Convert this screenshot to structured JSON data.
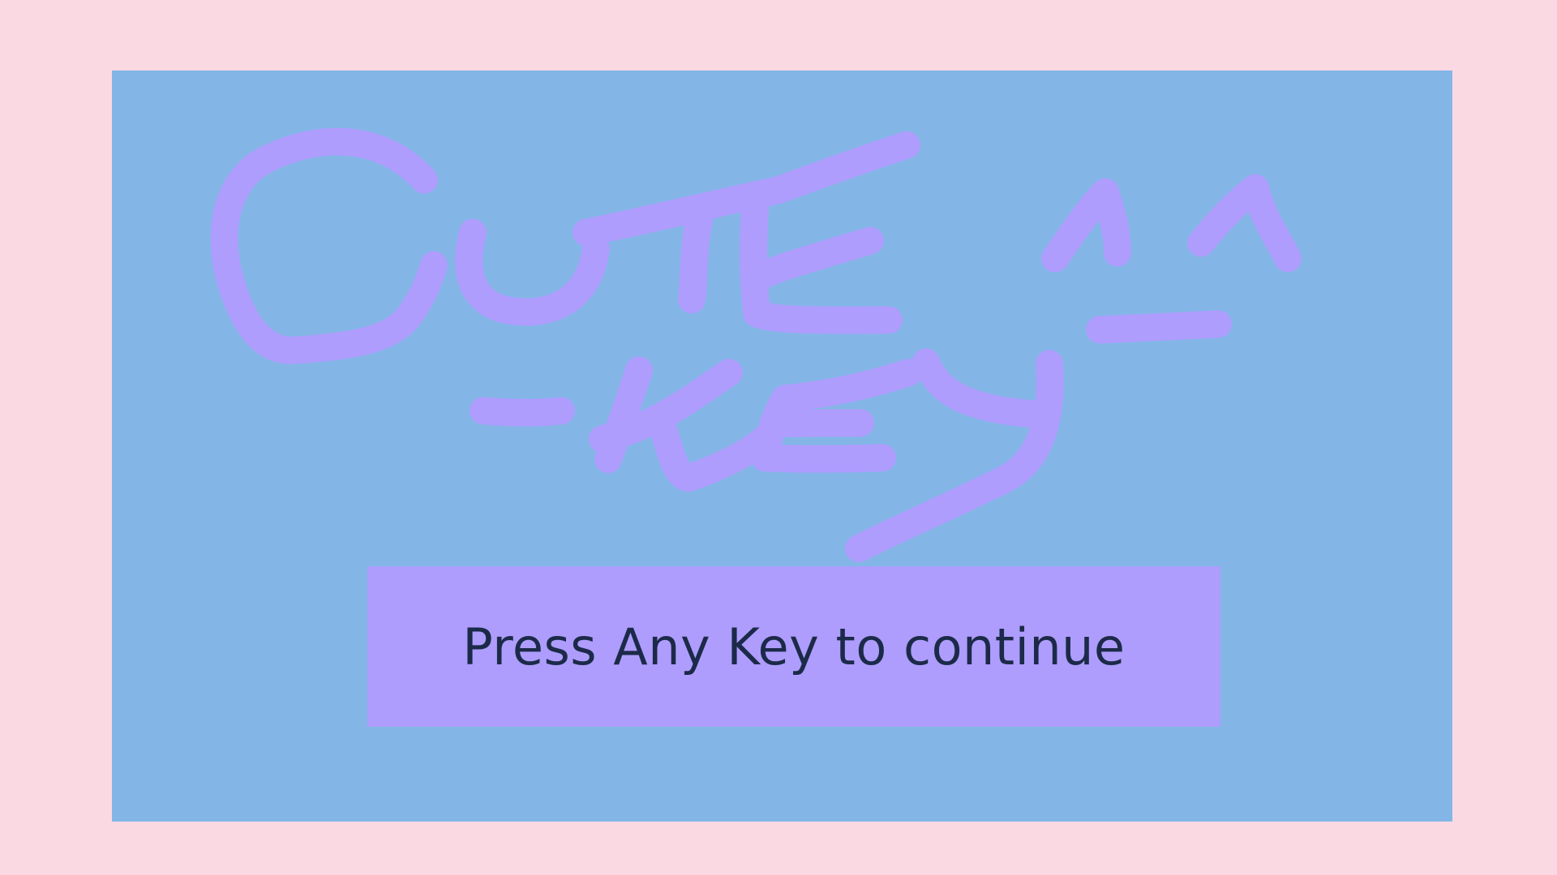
{
  "colors": {
    "outer_background": "#fad9e3",
    "screen_background": "#83b6e7",
    "logo_stroke": "#ae9dfd",
    "prompt_box": "#ae9dfd",
    "prompt_text": "#1c2a49"
  },
  "logo": {
    "text": "CUTE-KEY ^_^",
    "style": "hand-drawn"
  },
  "prompt": {
    "label": "Press Any Key to continue"
  }
}
